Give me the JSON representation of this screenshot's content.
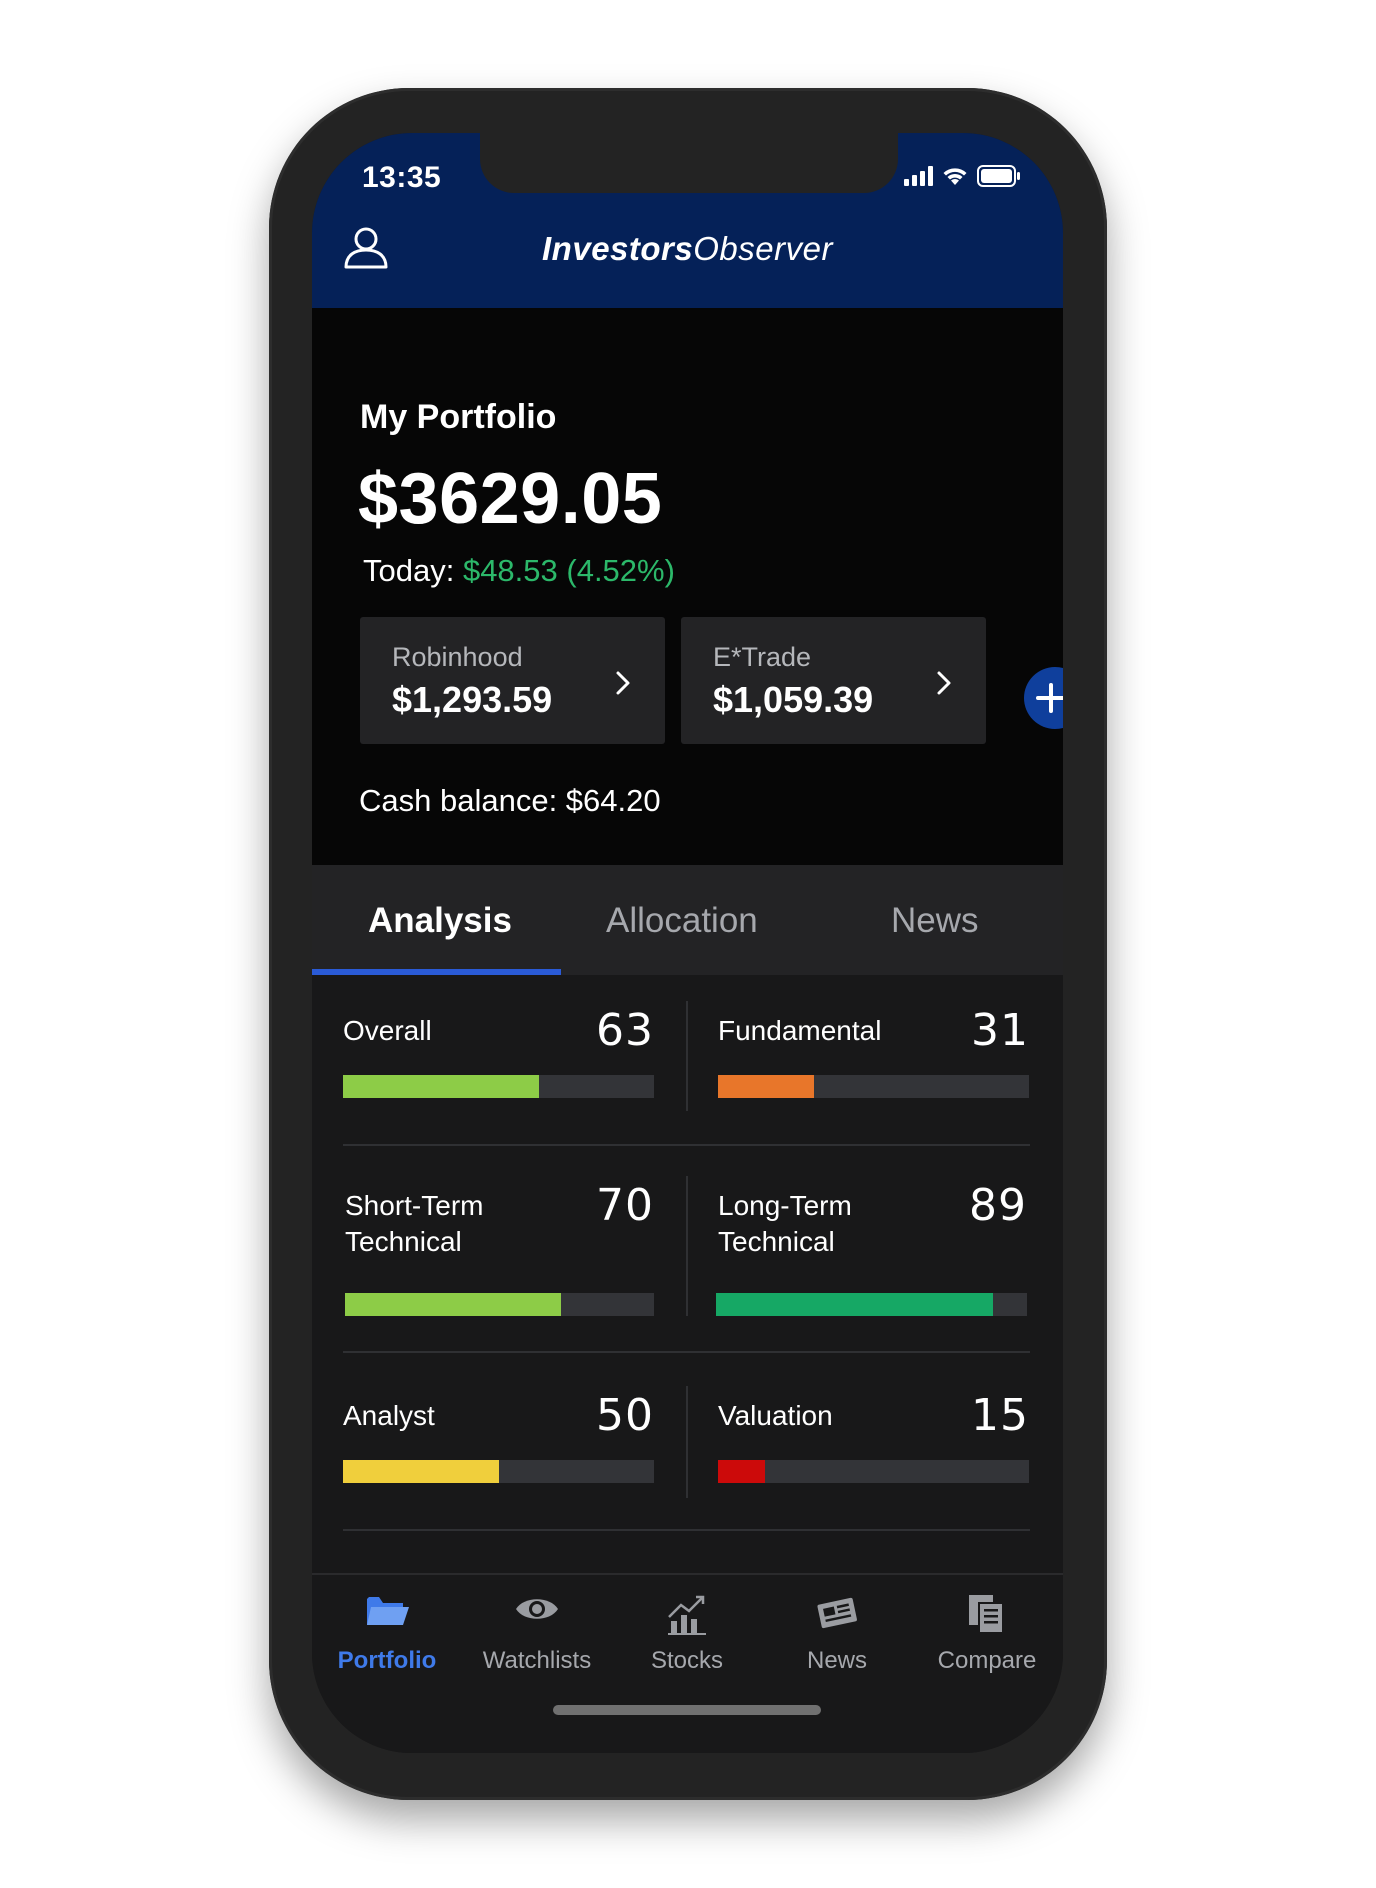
{
  "status_bar": {
    "time": "13:35",
    "icons": [
      "cellular-signal-icon",
      "wifi-icon",
      "battery-icon"
    ]
  },
  "header": {
    "logo_part1": "Investors",
    "logo_part2": "Observer",
    "icons": [
      "user-profile-icon"
    ]
  },
  "portfolio": {
    "title": "My Portfolio",
    "value": "$3629.05",
    "today_label": "Today: ",
    "today_change": "$48.53 (4.52%)",
    "accounts": [
      {
        "name": "Robinhood",
        "balance": "$1,293.59"
      },
      {
        "name": "E*Trade",
        "balance": "$1,059.39"
      }
    ],
    "cash_balance": "Cash balance: $64.20"
  },
  "tabs": [
    {
      "label": "Analysis",
      "active": true
    },
    {
      "label": "Allocation",
      "active": false
    },
    {
      "label": "News",
      "active": false
    }
  ],
  "scores": [
    {
      "label": "Overall",
      "value": "63",
      "percent": 63,
      "color": "#8dcc47"
    },
    {
      "label": "Fundamental",
      "value": "31",
      "percent": 31,
      "color": "#e8762a"
    },
    {
      "label": "Short-Term Technical",
      "value": "70",
      "percent": 70,
      "color": "#8dcc47"
    },
    {
      "label": "Long-Term Technical",
      "value": "89",
      "percent": 89,
      "color": "#16a865"
    },
    {
      "label": "Analyst",
      "value": "50",
      "percent": 50,
      "color": "#f0cf3c"
    },
    {
      "label": "Valuation",
      "value": "15",
      "percent": 15,
      "color": "#cc0a0a"
    }
  ],
  "bottom_nav": [
    {
      "label": "Portfolio",
      "icon": "folder-icon",
      "active": true
    },
    {
      "label": "Watchlists",
      "icon": "eye-icon",
      "active": false
    },
    {
      "label": "Stocks",
      "icon": "stock-chart-icon",
      "active": false
    },
    {
      "label": "News",
      "icon": "newspaper-icon",
      "active": false
    },
    {
      "label": "Compare",
      "icon": "compare-documents-icon",
      "active": false
    }
  ],
  "colors": {
    "header_bg": "#052158",
    "accent": "#2a5bd7",
    "positive": "#2cb86a"
  }
}
